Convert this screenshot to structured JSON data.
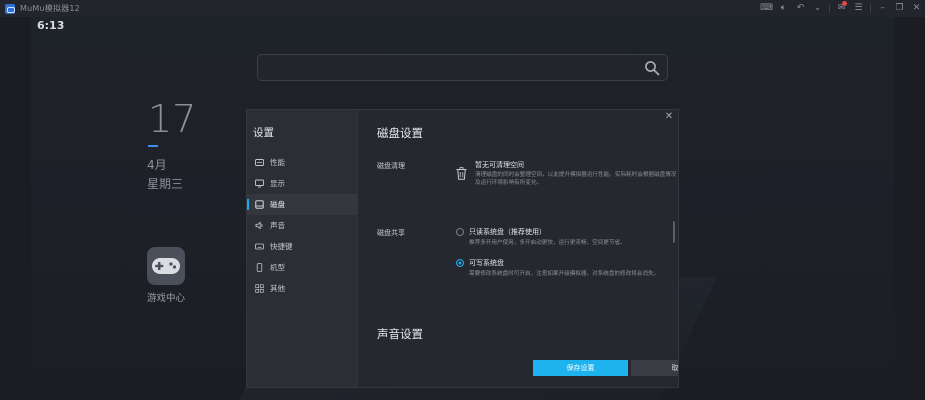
{
  "titlebar": {
    "app_title": "MuMu模拟器12",
    "icons": [
      "keyboard-icon",
      "volume-icon",
      "back-icon",
      "chevron-down-icon",
      "notification-icon",
      "menu-icon",
      "minimize-icon",
      "restore-icon",
      "close-icon"
    ]
  },
  "android": {
    "clock": "6:13",
    "date_day": "17",
    "date_month": "4月",
    "date_weekday": "星期三",
    "app_label": "游戏中心"
  },
  "settings": {
    "title": "设置",
    "nav": [
      {
        "label": "性能",
        "icon": "performance-icon"
      },
      {
        "label": "显示",
        "icon": "display-icon"
      },
      {
        "label": "磁盘",
        "icon": "disk-icon",
        "active": true
      },
      {
        "label": "声音",
        "icon": "sound-icon"
      },
      {
        "label": "快捷键",
        "icon": "keyboard-icon"
      },
      {
        "label": "机型",
        "icon": "phone-icon"
      },
      {
        "label": "其他",
        "icon": "grid-icon"
      }
    ],
    "disk": {
      "section_title": "磁盘设置",
      "cleanup_label": "磁盘清理",
      "cleanup_title": "暂无可清理空间",
      "cleanup_desc": "清理磁盘的同时会整理空间，以此提升模拟器运行性能。实际耗时会根据磁盘情况及运行环境影响有所变化。",
      "share_label": "磁盘共享",
      "option_readonly_title": "只读系统盘（推荐使用）",
      "option_readonly_desc": "推荐多开用户使用，多开启动更快，运行更流畅，空间更节省。",
      "option_writable_title": "可写系统盘",
      "option_writable_desc": "需要修改系统盘时可开启，注意如果升级模拟器，对系统盘的修改将会消失。",
      "selected_option": "可写系统盘"
    },
    "sound_section_title": "声音设置",
    "save_label": "保存设置",
    "cancel_label": "取消"
  },
  "colors": {
    "accent": "#1eb2ef",
    "background": "#1c1f25",
    "dialog": "#25282e"
  }
}
